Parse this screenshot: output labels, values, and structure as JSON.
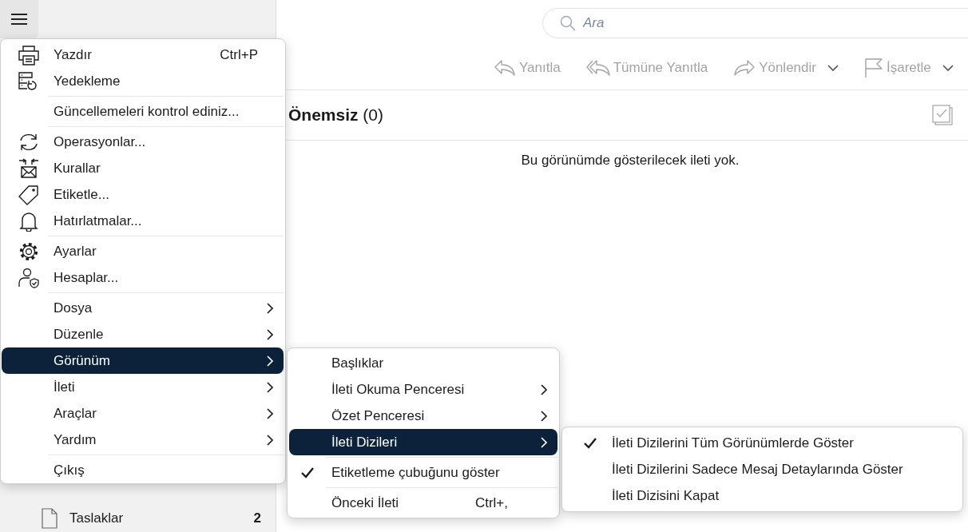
{
  "sidebar": {
    "folders": [
      {
        "name": "Taslaklar",
        "count": "2"
      }
    ]
  },
  "search": {
    "placeholder": "Ara"
  },
  "toolbar": [
    {
      "label": "Yanıtla",
      "disabled": true,
      "dropdown": false
    },
    {
      "label": "Tümüne Yanıtla",
      "disabled": true,
      "dropdown": false
    },
    {
      "label": "Yönlendir",
      "disabled": true,
      "dropdown": true
    },
    {
      "label": "İşaretle",
      "disabled": true,
      "dropdown": true
    }
  ],
  "folder_header": {
    "title": "Önemsiz",
    "count": "(0)"
  },
  "empty_message": "Bu görünümde gösterilecek ileti yok.",
  "main_menu": {
    "items": [
      {
        "kind": "action",
        "label": "Yazdır",
        "shortcut": "Ctrl+P",
        "selected": false
      },
      {
        "kind": "action",
        "label": "Yedekleme",
        "selected": false
      },
      {
        "kind": "separator"
      },
      {
        "kind": "action",
        "label": "Güncellemeleri kontrol ediniz...",
        "selected": false
      },
      {
        "kind": "separator"
      },
      {
        "kind": "action",
        "label": "Operasyonlar...",
        "selected": false
      },
      {
        "kind": "action",
        "label": "Kurallar",
        "selected": false
      },
      {
        "kind": "action",
        "label": "Etiketle...",
        "selected": false
      },
      {
        "kind": "action",
        "label": "Hatırlatmalar...",
        "selected": false
      },
      {
        "kind": "separator"
      },
      {
        "kind": "action",
        "label": "Ayarlar",
        "selected": false
      },
      {
        "kind": "action",
        "label": "Hesaplar...",
        "selected": false
      },
      {
        "kind": "separator"
      },
      {
        "kind": "submenu",
        "label": "Dosya",
        "selected": false
      },
      {
        "kind": "submenu",
        "label": "Düzenle",
        "selected": false
      },
      {
        "kind": "submenu",
        "label": "Görünüm",
        "selected": true
      },
      {
        "kind": "submenu",
        "label": "İleti",
        "selected": false
      },
      {
        "kind": "submenu",
        "label": "Araçlar",
        "selected": false
      },
      {
        "kind": "submenu",
        "label": "Yardım",
        "selected": false
      },
      {
        "kind": "separator"
      },
      {
        "kind": "action",
        "label": "Çıkış",
        "selected": false
      }
    ]
  },
  "view_menu": {
    "items": [
      {
        "kind": "action",
        "label": "Başlıklar",
        "checked": false,
        "selected": false
      },
      {
        "kind": "submenu",
        "label": "İleti Okuma Penceresi",
        "checked": false,
        "selected": false
      },
      {
        "kind": "submenu",
        "label": "Özet Penceresi",
        "checked": false,
        "selected": false
      },
      {
        "kind": "submenu",
        "label": "İleti Dizileri",
        "checked": false,
        "selected": true
      },
      {
        "kind": "separator"
      },
      {
        "kind": "action",
        "label": "Etiketleme çubuğunu göster",
        "checked": true,
        "selected": false
      },
      {
        "kind": "separator"
      },
      {
        "kind": "action",
        "label": "Önceki İleti",
        "shortcut": "Ctrl+,",
        "checked": false,
        "selected": false
      }
    ]
  },
  "threads_menu": {
    "items": [
      {
        "kind": "action",
        "label": "İleti Dizilerini Tüm Görünümlerde Göster",
        "checked": true,
        "selected": false
      },
      {
        "kind": "action",
        "label": "İleti Dizilerini Sadece Mesaj Detaylarında Göster",
        "checked": false,
        "selected": false
      },
      {
        "kind": "action",
        "label": "İleti Dizisini Kapat",
        "checked": false,
        "selected": false
      }
    ]
  }
}
